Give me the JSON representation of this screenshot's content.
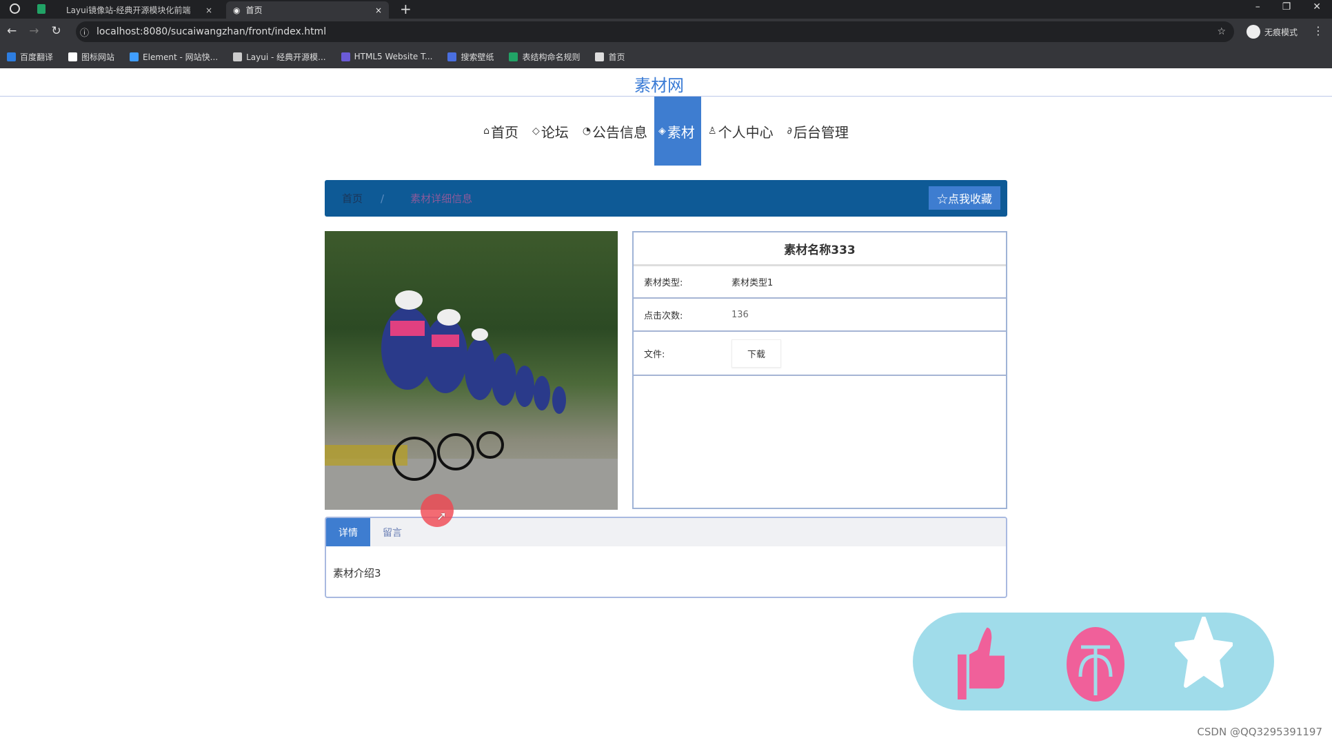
{
  "browser": {
    "tabs": [
      {
        "label": "Layui镜像站-经典开源模块化前端"
      },
      {
        "label": "首页"
      }
    ],
    "url": "localhost:8080/sucaiwangzhan/front/index.html",
    "profile": "无痕模式",
    "bookmarks": [
      {
        "label": "百度翻译",
        "color": "#2d7de0"
      },
      {
        "label": "图标网站",
        "color": "#ffffff"
      },
      {
        "label": "Element - 网站快...",
        "color": "#409eff"
      },
      {
        "label": "Layui - 经典开源模...",
        "color": "#cccccc"
      },
      {
        "label": "HTML5 Website T...",
        "color": "#6b5bd6"
      },
      {
        "label": "搜索壁纸",
        "color": "#4a6fe0"
      },
      {
        "label": "表结构命名规则",
        "color": "#21a366"
      },
      {
        "label": "首页",
        "color": "#dddddd"
      }
    ]
  },
  "site": {
    "title": "素材网"
  },
  "nav": [
    {
      "label": "首页",
      "icon": "home-icon"
    },
    {
      "label": "论坛",
      "icon": "tag-icon"
    },
    {
      "label": "公告信息",
      "icon": "palette-icon"
    },
    {
      "label": "素材",
      "icon": "layers-icon",
      "active": true
    },
    {
      "label": "个人中心",
      "icon": "user-icon"
    },
    {
      "label": "后台管理",
      "icon": "link-icon"
    }
  ],
  "breadcrumb": {
    "home": "首页",
    "sep": "/",
    "current": "素材详细信息"
  },
  "favorite_button": "☆点我收藏",
  "detail": {
    "name": "素材名称333",
    "rows": [
      {
        "label": "素材类型:",
        "value": "素材类型1"
      },
      {
        "label": "点击次数:",
        "value": "136"
      }
    ],
    "file_label": "文件:",
    "download_button": "下载"
  },
  "tabs": [
    {
      "label": "详情",
      "active": true
    },
    {
      "label": "留言"
    }
  ],
  "content": "素材介绍3",
  "actions": {
    "color": "#f0609a",
    "bg": "#a0dcea",
    "icons": [
      "thumbs-up-icon",
      "top-icon",
      "star-icon"
    ]
  },
  "watermark": "CSDN @QQ3295391197"
}
